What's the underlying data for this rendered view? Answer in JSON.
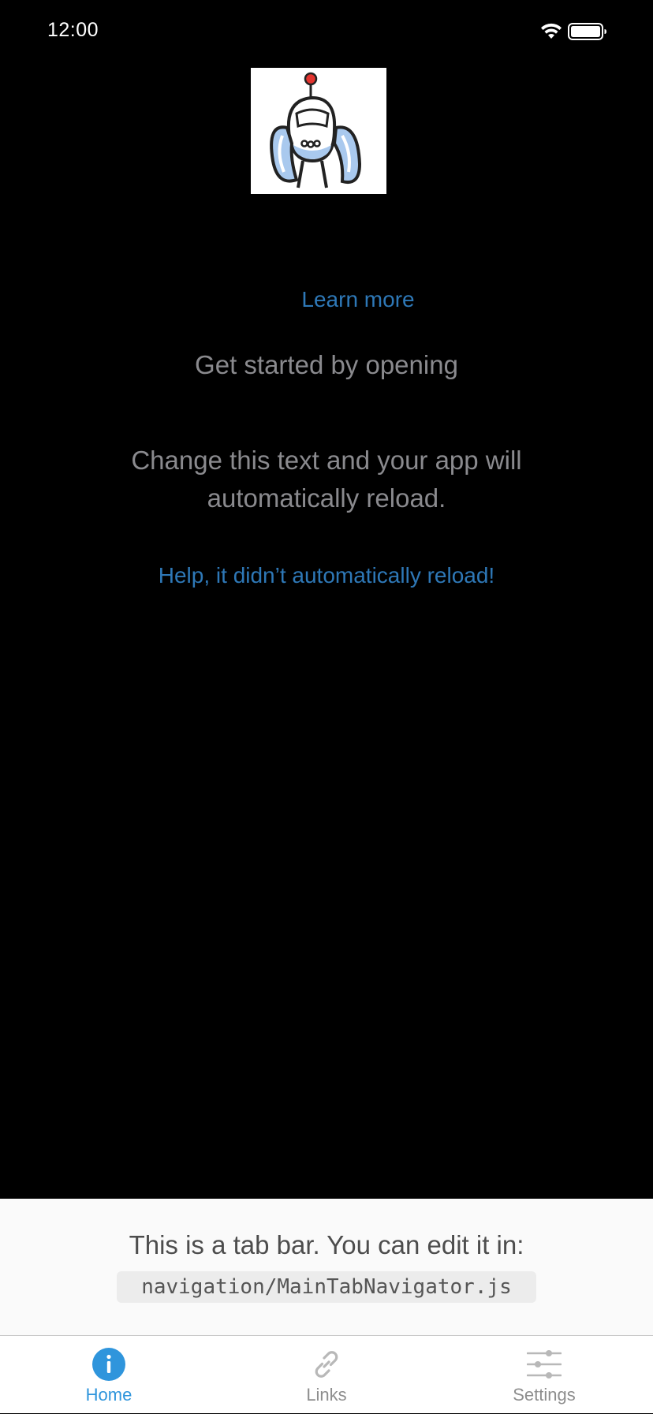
{
  "status_bar": {
    "time": "12:00"
  },
  "main": {
    "learn_more": "Learn more",
    "get_started": "Get started by opening",
    "change_text": "Change this text and your app will automatically reload.",
    "help_link": "Help, it didn’t automatically reload!"
  },
  "tab_bar_info": {
    "text": "This is a tab bar. You can edit it in:",
    "code_path": "navigation/MainTabNavigator.js"
  },
  "tabs": [
    {
      "label": "Home",
      "icon": "info-icon",
      "active": true
    },
    {
      "label": "Links",
      "icon": "link-icon",
      "active": false
    },
    {
      "label": "Settings",
      "icon": "sliders-icon",
      "active": false
    }
  ],
  "colors": {
    "background": "#000000",
    "link": "#2e78b7",
    "muted_text": "#8a8a8e",
    "tab_active": "#2f95dc",
    "tab_inactive": "#8e8e8e",
    "tab_bar_bg": "#fafafa"
  }
}
